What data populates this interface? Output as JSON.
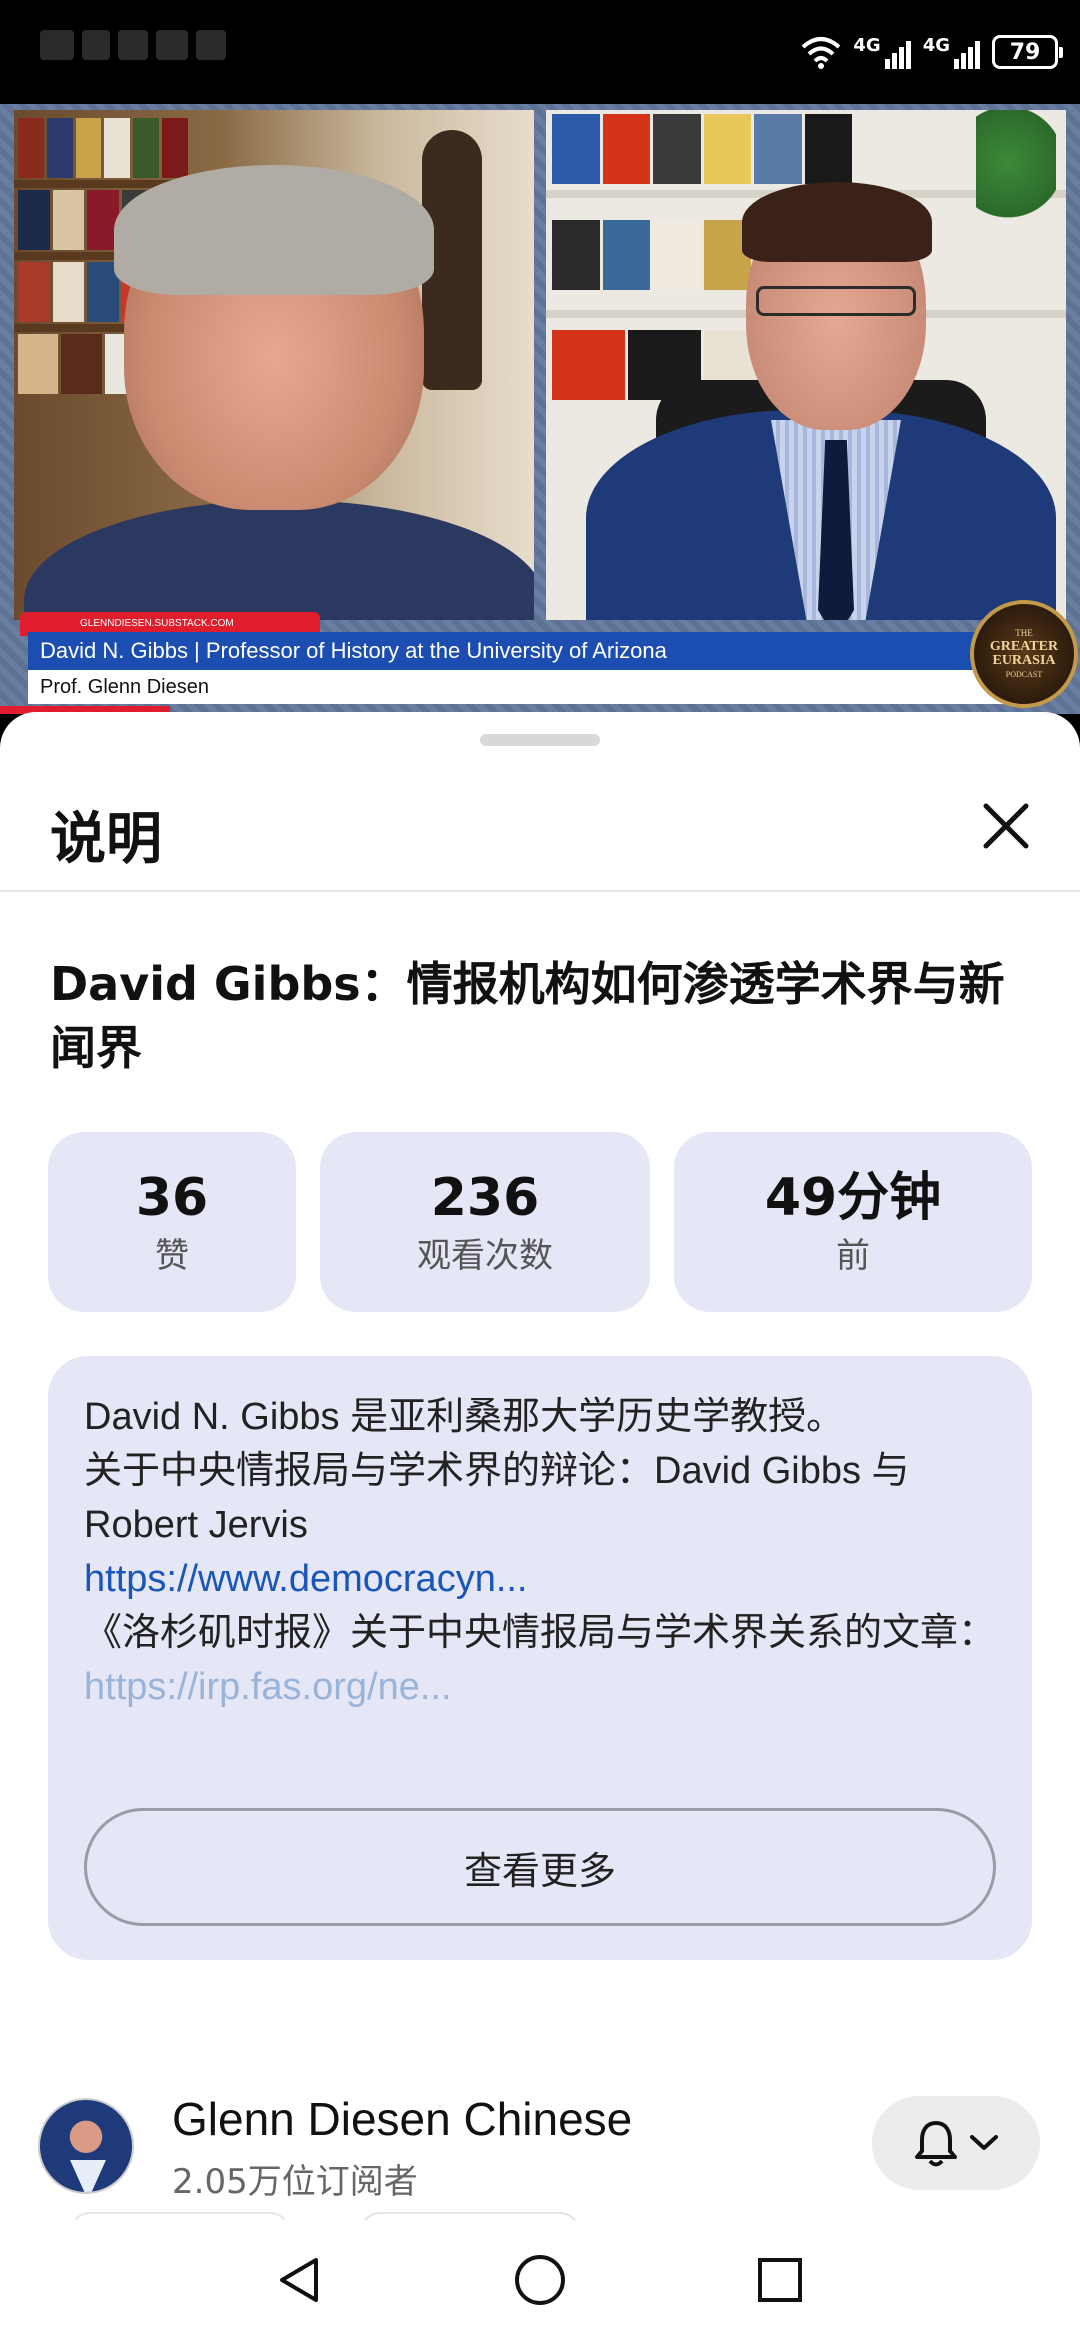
{
  "status_bar": {
    "network_1": "4G",
    "network_2": "4G",
    "battery": "79"
  },
  "video": {
    "lower_third_title": "David N. Gibbs | Professor of History at the University of Arizona",
    "lower_third_subtitle": "Prof. Glenn Diesen",
    "lower_third_tag": "GLENNDIESEN.SUBSTACK.COM",
    "badge_small_top": "THE",
    "badge_line1": "GREATER",
    "badge_line2": "EURASIA",
    "badge_small_bottom": "PODCAST"
  },
  "sheet": {
    "header_title": "说明",
    "video_title": "David Gibbs：情报机构如何渗透学术界与新闻界",
    "stats": [
      {
        "value": "36",
        "label": "赞"
      },
      {
        "value": "236",
        "label": "观看次数"
      },
      {
        "value": "49分钟",
        "label": "前"
      }
    ],
    "description": {
      "line1": "David N. Gibbs 是亚利桑那大学历史学教授。",
      "line2": "关于中央情报局与学术界的辩论：David Gibbs 与 Robert Jervis",
      "link1": "https://www.democracyn...",
      "line3": "《洛杉矶时报》关于中央情报局与学术界关系的文章：",
      "link2": "https://irp.fas.org/ne..."
    },
    "more_button": "查看更多",
    "channel": {
      "name": "Glenn Diesen Chinese",
      "subscribers": "2.05万位订阅者"
    }
  },
  "icons": {
    "close": "close-icon",
    "bell": "bell-icon",
    "chevron": "chevron-down-icon",
    "back": "back-icon",
    "home": "home-icon",
    "recents": "recents-icon"
  },
  "colors": {
    "accent_blue": "#1c4db0",
    "link": "#1a56b8",
    "card_bg": "#e5e7f7",
    "youtube_red": "#e01d2c"
  }
}
